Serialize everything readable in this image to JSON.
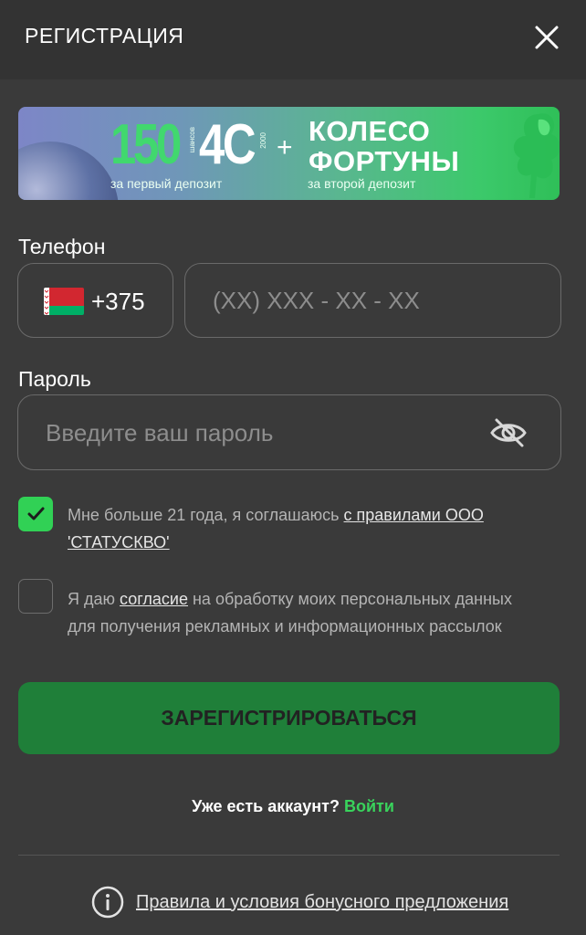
{
  "header": {
    "title": "РЕГИСТРАЦИЯ",
    "close_icon": "close-icon"
  },
  "banner": {
    "amount1": "150",
    "amount1_unit": "шансов",
    "amount2": "4С",
    "amount2_unit": "2000",
    "plus": "+",
    "wheel_line1": "КОЛЕСО",
    "wheel_line2": "ФОРТУНЫ",
    "caption1": "за первый депозит",
    "caption2": "за второй депозит"
  },
  "phone": {
    "label": "Телефон",
    "country_code": "+375",
    "flag_icon": "belarus-flag-icon",
    "placeholder": "(XX) XXX - XX - XX",
    "value": ""
  },
  "password": {
    "label": "Пароль",
    "placeholder": "Введите ваш пароль",
    "value": "",
    "toggle_icon": "eye-slash-icon"
  },
  "consent_age": {
    "checked": true,
    "text": "Мне больше 21 года, я соглашаюсь ",
    "link": "с правилами ООО 'СТАТУСКВО'"
  },
  "consent_marketing": {
    "checked": false,
    "text_before": "Я даю ",
    "link": "согласие",
    "text_after": " на обработку моих персональных данных для получения рекламных и информационных рассылок"
  },
  "register_button": "ЗАРЕГИСТРИРОВАТЬСЯ",
  "login": {
    "text": "Уже есть аккаунт? ",
    "link": "Войти"
  },
  "rules": {
    "icon": "info-icon",
    "link": "Правила и условия бонусного предложения"
  },
  "colors": {
    "background": "#3a3a3a",
    "header": "#333333",
    "accent_green": "#31d155",
    "button_green": "#1f7f39",
    "link_green": "#39d35c"
  }
}
